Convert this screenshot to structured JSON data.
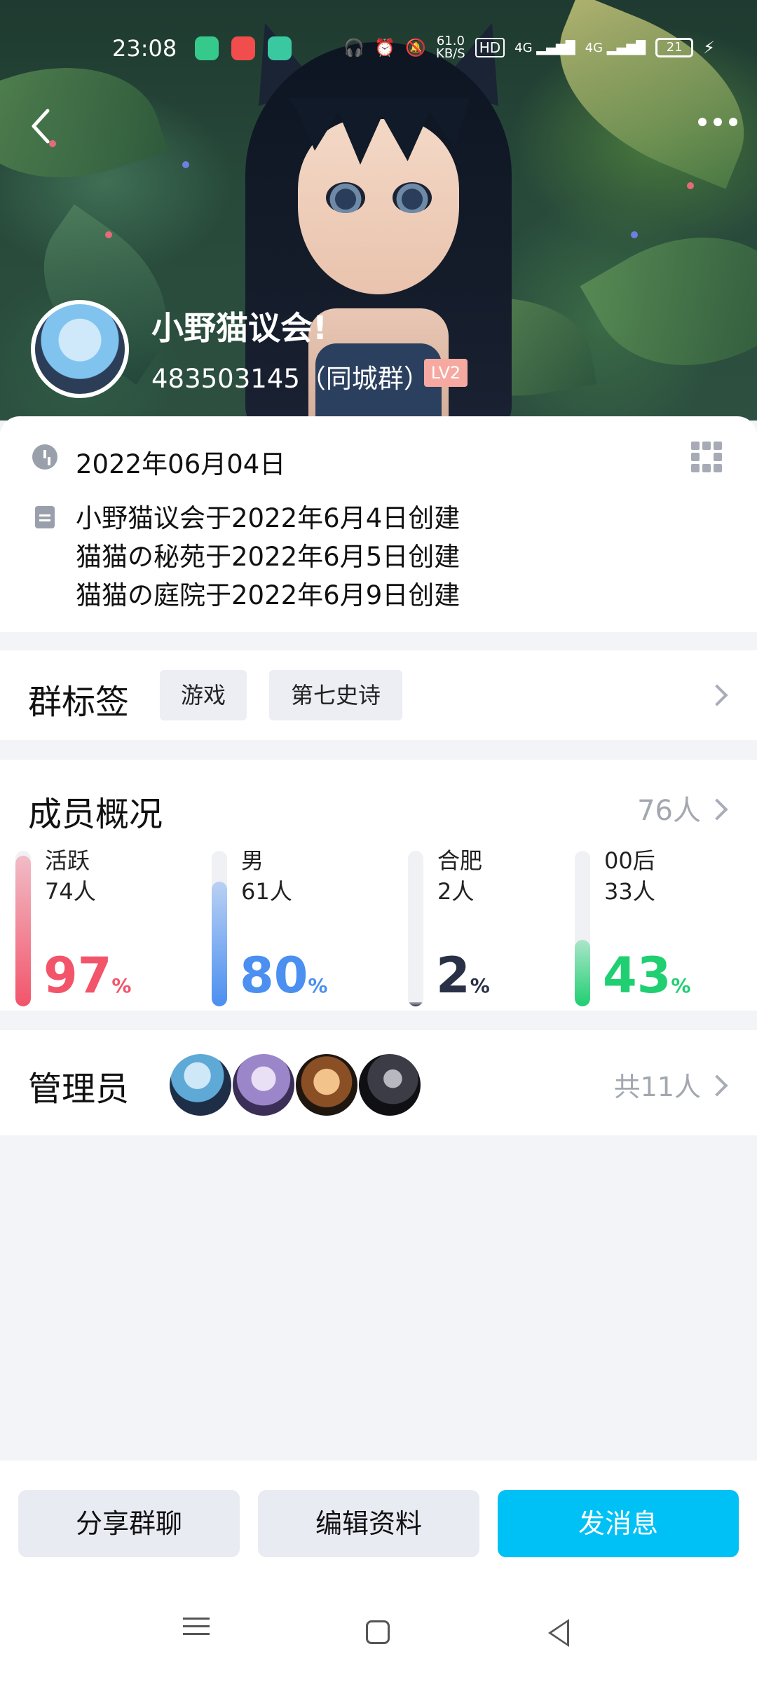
{
  "status_bar": {
    "time": "23:08",
    "net_speed_value": "61.0",
    "net_speed_unit": "KB/S",
    "hd": "HD",
    "net1": "4G",
    "net2": "4G",
    "battery": "21"
  },
  "header": {
    "group_name": "小野猫议会!",
    "group_id": "483503145（同城群）",
    "level": "LV2"
  },
  "info": {
    "date": "2022年06月04日",
    "description": [
      "小野猫议会于2022年6月4日创建",
      "猫猫の秘苑于2022年6月5日创建",
      "猫猫の庭院于2022年6月9日创建"
    ]
  },
  "tags": {
    "title": "群标签",
    "items": [
      "游戏",
      "第七史诗"
    ]
  },
  "members": {
    "title": "成员概况",
    "count": "76人",
    "stats": [
      {
        "label": "活跃",
        "count": "74人",
        "percent": "97",
        "value": 0.97,
        "color": "#f2546a"
      },
      {
        "label": "男",
        "count": "61人",
        "percent": "80",
        "value": 0.8,
        "color": "#4b8ff0"
      },
      {
        "label": "合肥",
        "count": "2人",
        "percent": "2",
        "value": 0.02,
        "color": "#2a3046"
      },
      {
        "label": "00后",
        "count": "33人",
        "percent": "43",
        "value": 0.43,
        "color": "#1fcf71"
      }
    ],
    "percent_sign": "%"
  },
  "admins": {
    "title": "管理员",
    "total": "共11人"
  },
  "actions": {
    "share": "分享群聊",
    "edit": "编辑资料",
    "send": "发消息"
  }
}
